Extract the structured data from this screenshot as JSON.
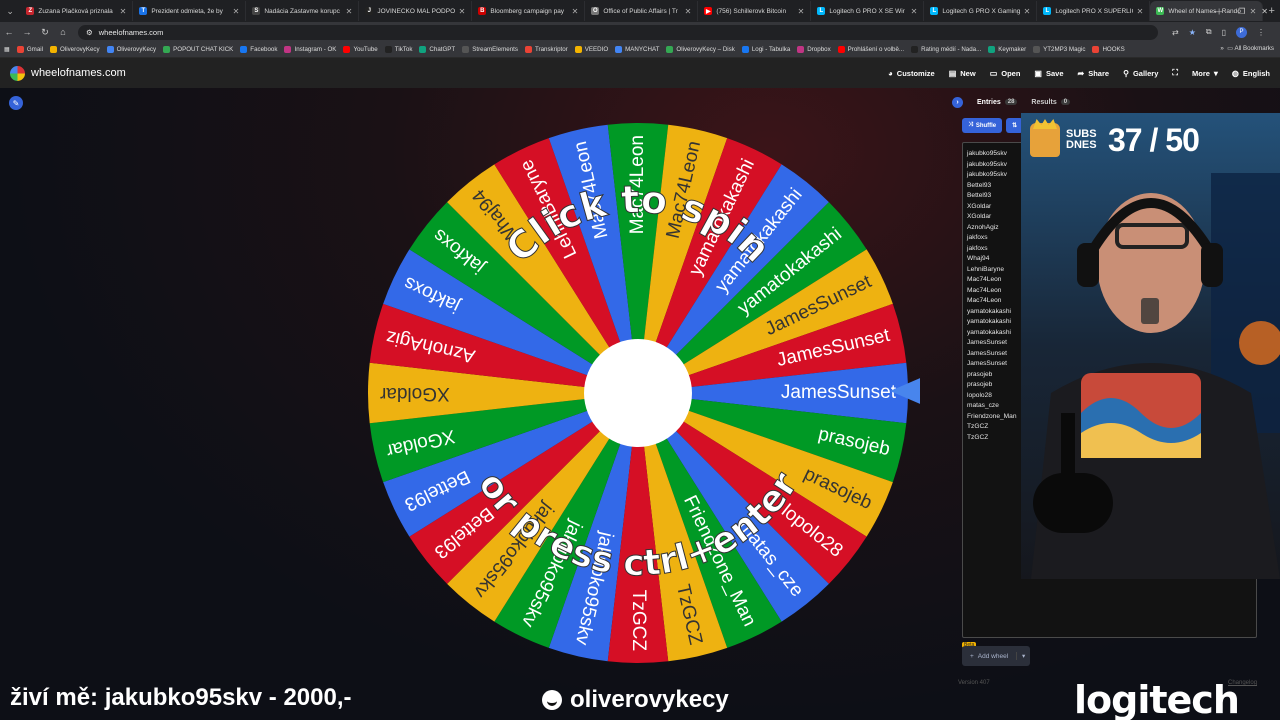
{
  "browser": {
    "tabs": [
      {
        "title": "Zuzana Plačková priznala",
        "fav": "#c6262e",
        "icon": "Z"
      },
      {
        "title": "Prezident odmieta, že by",
        "fav": "#1a73e8",
        "icon": "T"
      },
      {
        "title": "Nadácia Zastavme korupc",
        "fav": "#444",
        "icon": "S"
      },
      {
        "title": "JOVINEČKO MAL PODPOR",
        "fav": "#222",
        "icon": "J"
      },
      {
        "title": "Bloomberg campaign pay",
        "fav": "#c00",
        "icon": "B"
      },
      {
        "title": "Office of Public Affairs | Tr",
        "fav": "#777",
        "icon": "O"
      },
      {
        "title": "(756) Schillerovk Bitcoin",
        "fav": "#ff0000",
        "icon": "▶"
      },
      {
        "title": "Logitech G PRO X SE Wir",
        "fav": "#00b8fc",
        "icon": "L"
      },
      {
        "title": "Logitech G PRO X Gaming",
        "fav": "#00b8fc",
        "icon": "L"
      },
      {
        "title": "Logitech PRO X SUPERLIG",
        "fav": "#00b8fc",
        "icon": "L"
      },
      {
        "title": "Wheel of Names | Rando",
        "fav": "#3cba54",
        "icon": "W"
      }
    ],
    "url": "wheelofnames.com",
    "bookmarks": [
      "Gmail",
      "OliverovyKecy",
      "OliverovyKecy",
      "POPOUT CHAT KICK",
      "Facebook",
      "Instagram - OK",
      "YouTube",
      "TikTok",
      "ChatGPT",
      "StreamElements",
      "Transkriptor",
      "VEEDIO",
      "MANYCHAT",
      "OliverovyKecy – Disk",
      "Logi - Tabulka",
      "Dropbox",
      "Prohlášení o volbě...",
      "Rating médií - Nada...",
      "Keymaker",
      "YT2MP3 Magic",
      "HOOKS"
    ],
    "all_bookmarks": "All Bookmarks"
  },
  "header": {
    "site_name": "wheelofnames.com",
    "menu": {
      "customize": "Customize",
      "new": "New",
      "open": "Open",
      "save": "Save",
      "share": "Share",
      "gallery": "Gallery",
      "more": "More",
      "language": "English"
    }
  },
  "wheel": {
    "overlay_top": "Click to spin",
    "overlay_bottom": "or press ctrl+enter",
    "colors": [
      "#3369e8",
      "#009925",
      "#eeb211",
      "#d50f25"
    ],
    "entries": [
      "jakubko95skv",
      "jakubko95skv",
      "jakubko95skv",
      "Bettel93",
      "Bettel93",
      "XGoldar",
      "XGoldar",
      "AznohAgiz",
      "jakfoxs",
      "jakfoxs",
      "Whaj94",
      "LehniBaryne",
      "Mac74Leon",
      "Mac74Leon",
      "Mac74Leon",
      "yamatokakashi",
      "yamatokakashi",
      "yamatokakashi",
      "JamesSunset",
      "JamesSunset",
      "JamesSunset",
      "prasojeb",
      "prasojeb",
      "lopolo28",
      "matas_cze",
      "Friendzone_Man",
      "TzGCZ",
      "TzGCZ"
    ]
  },
  "panel": {
    "entries_tab": "Entries",
    "entries_count": "28",
    "results_tab": "Results",
    "results_count": "0",
    "shuffle": "Shuffle",
    "sort_icon": "sort-icon",
    "entries": [
      "jakubko95skv",
      "jakubko95skv",
      "jakubko95skv",
      "Bettel93",
      "Bettel93",
      "XGoldar",
      "XGoldar",
      "AznohAgiz",
      "jakfoxs",
      "jakfoxs",
      "Whaj94",
      "LehniBaryne",
      "Mac74Leon",
      "Mac74Leon",
      "Mac74Leon",
      "yamatokakashi",
      "yamatokakashi",
      "yamatokakashi",
      "JamesSunset",
      "JamesSunset",
      "JamesSunset",
      "prasojeb",
      "prasojeb",
      "lopolo28",
      "matas_cze",
      "Friendzone_Man",
      "TzGCZ",
      "TzGCZ"
    ],
    "add_wheel": "Add wheel",
    "beta": "Beta",
    "version": "Version 407",
    "changelog": "Changelog"
  },
  "overlay": {
    "subs_label": "SUBS DNES",
    "subs_count": "37 / 50",
    "donation": "živí mě: jakubko95skv - 2000,-",
    "channel": "oliverovykecy",
    "sponsor": "logitech"
  }
}
